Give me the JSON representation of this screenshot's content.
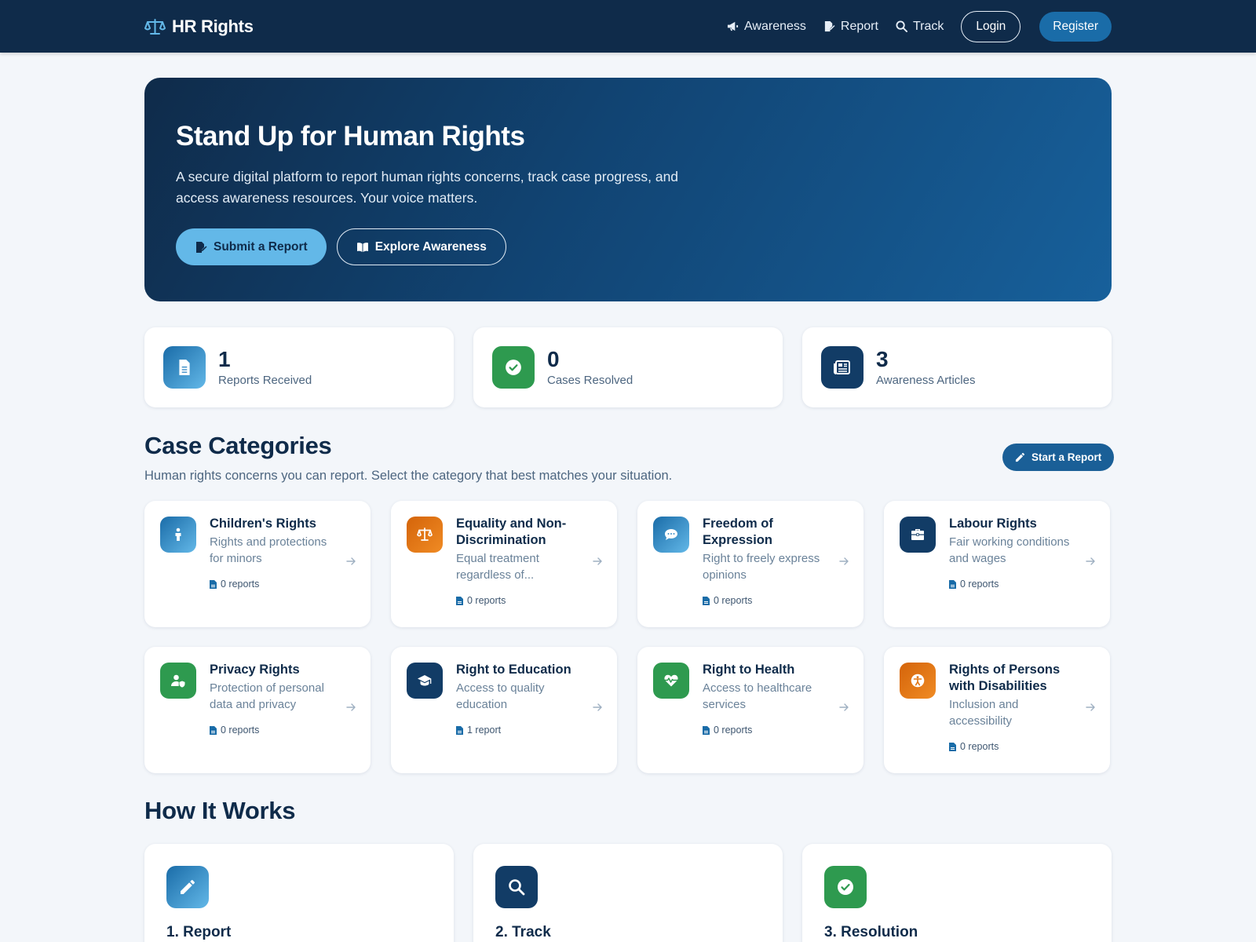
{
  "brand": {
    "name": "HR Rights",
    "icon": "scale-balance-icon"
  },
  "nav": {
    "links": [
      {
        "label": "Awareness",
        "icon": "megaphone-icon"
      },
      {
        "label": "Report",
        "icon": "file-signature-icon"
      },
      {
        "label": "Track",
        "icon": "search-icon"
      }
    ],
    "login_label": "Login",
    "register_label": "Register"
  },
  "hero": {
    "title": "Stand Up for Human Rights",
    "text": "A secure digital platform to report human rights concerns, track case progress, and access awareness resources. Your voice matters.",
    "primary_label": "Submit a Report",
    "secondary_label": "Explore Awareness"
  },
  "stats": [
    {
      "value": "1",
      "label": "Reports Received",
      "icon": "document-icon"
    },
    {
      "value": "0",
      "label": "Cases Resolved",
      "icon": "check-circle-icon"
    },
    {
      "value": "3",
      "label": "Awareness Articles",
      "icon": "newspaper-icon"
    }
  ],
  "categories_section": {
    "title": "Case Categories",
    "subtitle": "Human rights concerns you can report. Select the category that best matches your situation.",
    "start_label": "Start a Report"
  },
  "categories": [
    {
      "title": "Children's Rights",
      "desc": "Rights and protections for minors",
      "count": "0 reports",
      "icon": "child-icon"
    },
    {
      "title": "Equality and Non-Discrimination",
      "desc": "Equal treatment regardless of...",
      "count": "0 reports",
      "icon": "scale-balance-icon"
    },
    {
      "title": "Freedom of Expression",
      "desc": "Right to freely express opinions",
      "count": "0 reports",
      "icon": "speech-bubble-icon"
    },
    {
      "title": "Labour Rights",
      "desc": "Fair working conditions and wages",
      "count": "0 reports",
      "icon": "briefcase-icon"
    },
    {
      "title": "Privacy Rights",
      "desc": "Protection of personal data and privacy",
      "count": "0 reports",
      "icon": "user-shield-icon"
    },
    {
      "title": "Right to Education",
      "desc": "Access to quality education",
      "count": "1 report",
      "icon": "graduation-cap-icon"
    },
    {
      "title": "Right to Health",
      "desc": "Access to healthcare services",
      "count": "0 reports",
      "icon": "heart-pulse-icon"
    },
    {
      "title": "Rights of Persons with Disabilities",
      "desc": "Inclusion and accessibility",
      "count": "0 reports",
      "icon": "accessibility-icon"
    }
  ],
  "how_section": {
    "title": "How It Works"
  },
  "steps": [
    {
      "title": "1. Report",
      "icon": "pencil-icon"
    },
    {
      "title": "2. Track",
      "icon": "search-icon"
    },
    {
      "title": "3. Resolution",
      "icon": "check-circle-icon"
    }
  ],
  "colors": {
    "navy": "#0f2b4a",
    "blue": "#1a6ca8",
    "sky": "#63b8e8",
    "green": "#2e9a4f",
    "orange": "#e0730f"
  }
}
